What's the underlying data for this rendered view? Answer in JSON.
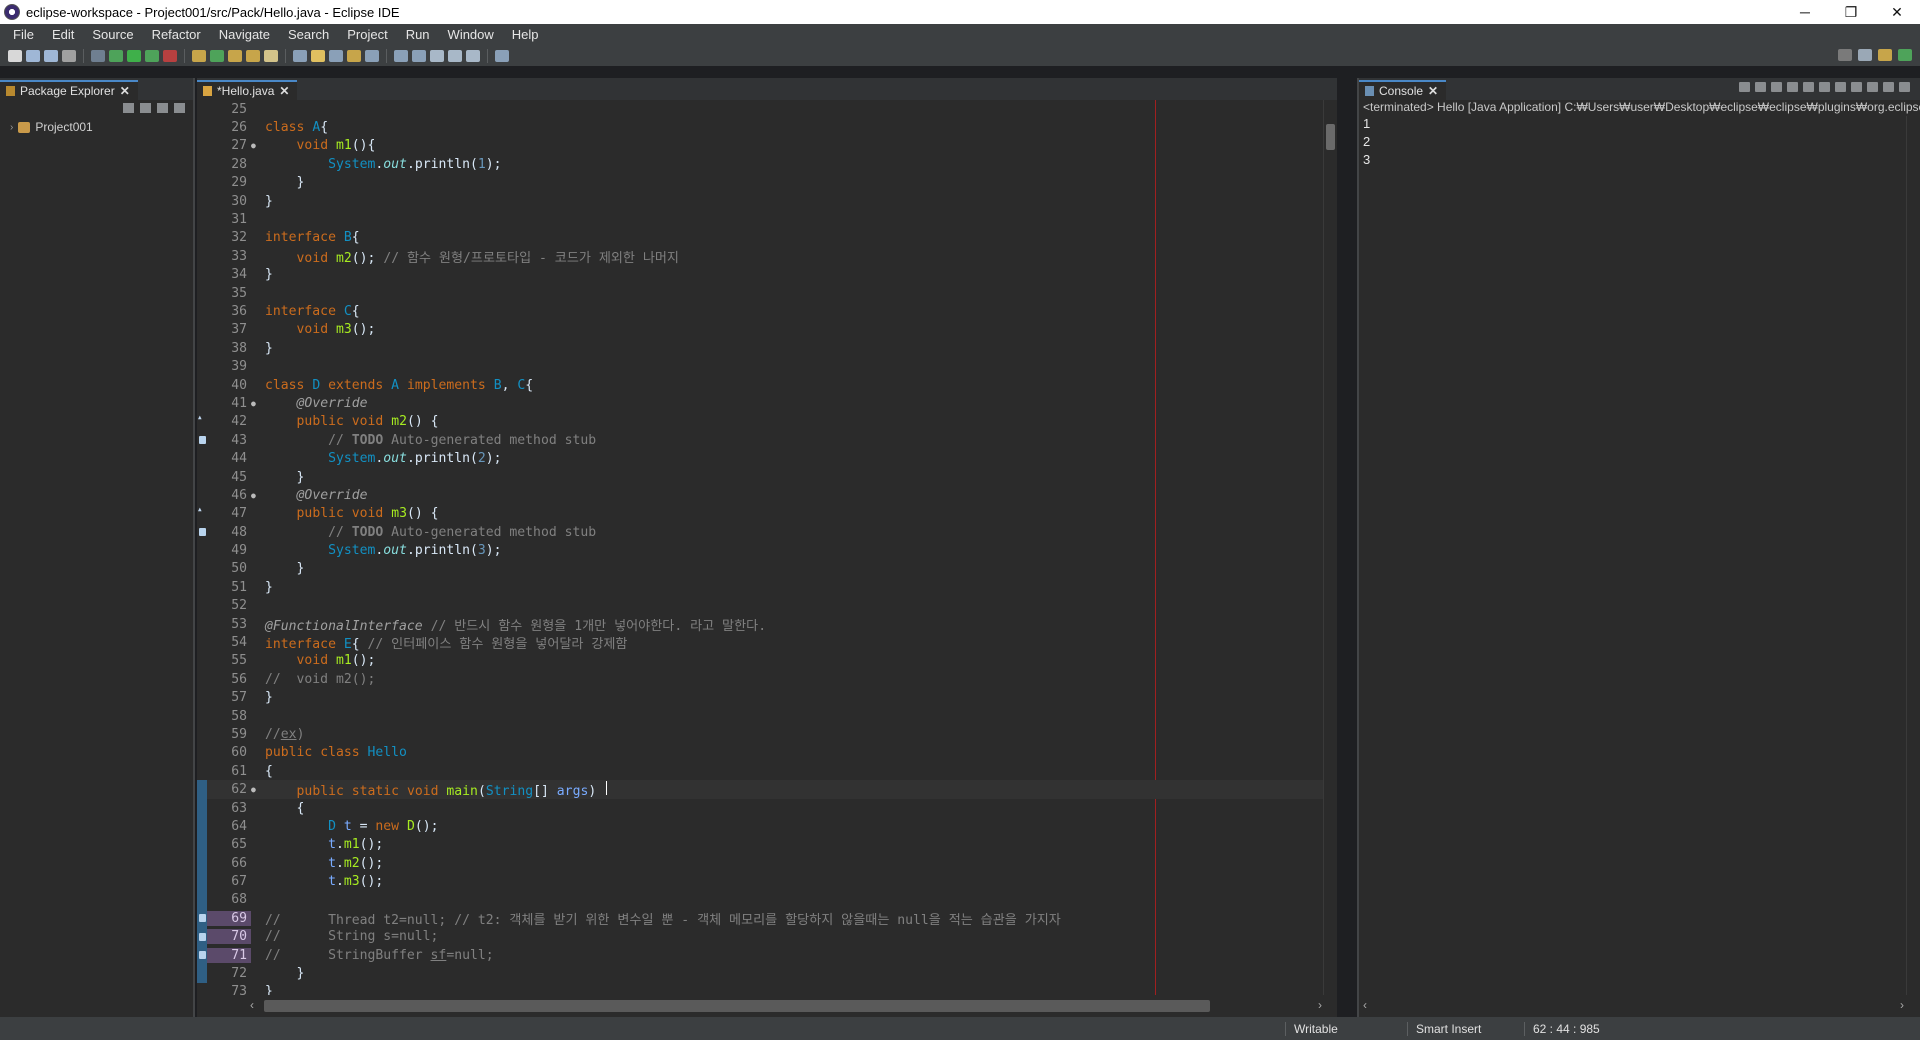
{
  "window": {
    "title": "eclipse-workspace - Project001/src/Pack/Hello.java - Eclipse IDE",
    "minimize": "─",
    "restore": "❐",
    "close": "✕"
  },
  "menu": [
    "File",
    "Edit",
    "Source",
    "Refactor",
    "Navigate",
    "Search",
    "Project",
    "Run",
    "Window",
    "Help"
  ],
  "package_explorer": {
    "tab_label": "Package Explorer",
    "close_glyph": "✕",
    "project": "Project001"
  },
  "editor": {
    "tab_label": "*Hello.java",
    "close_glyph": "✕"
  },
  "console": {
    "tab_label": "Console",
    "close_glyph": "✕",
    "header": "<terminated> Hello [Java Application] C:₩Users₩user₩Desktop₩eclipse₩eclipse₩plugins₩org.eclipse.j",
    "output": [
      "1",
      "2",
      "3"
    ]
  },
  "status": {
    "writable": "Writable",
    "insert_mode": "Smart Insert",
    "position": "62 : 44 : 985"
  },
  "colors": {
    "keyword": "#cc6c1d",
    "type": "#1290c3",
    "comment": "#808080",
    "background": "#2b2b2b"
  },
  "code_lines": [
    {
      "n": "25",
      "html": ""
    },
    {
      "n": "26",
      "html": "<span class='kw'>class</span> <span class='typ'>A</span>{"
    },
    {
      "n": "27",
      "fold": "●",
      "html": "    <span class='kw'>void</span> <span class='meth'>m1</span>(){"
    },
    {
      "n": "28",
      "html": "        <span class='typ'>System</span>.<span class='field'>out</span>.println(<span class='num'>1</span>);"
    },
    {
      "n": "29",
      "html": "    }"
    },
    {
      "n": "30",
      "html": "}"
    },
    {
      "n": "31",
      "html": ""
    },
    {
      "n": "32",
      "html": "<span class='kw'>interface</span> <span class='typ'>B</span>{"
    },
    {
      "n": "33",
      "html": "    <span class='kw'>void</span> <span class='meth'>m2</span>(); <span class='cmt'>// 함수 원형/프로토타입 - 코드가 제외한 나머지</span>"
    },
    {
      "n": "34",
      "html": "}"
    },
    {
      "n": "35",
      "html": ""
    },
    {
      "n": "36",
      "html": "<span class='kw'>interface</span> <span class='typ'>C</span>{"
    },
    {
      "n": "37",
      "html": "    <span class='kw'>void</span> <span class='meth'>m3</span>();"
    },
    {
      "n": "38",
      "html": "}"
    },
    {
      "n": "39",
      "html": ""
    },
    {
      "n": "40",
      "html": "<span class='kw'>class</span> <span class='typ'>D</span> <span class='kw'>extends</span> <span class='typ'>A</span> <span class='kw'>implements</span> <span class='typ'>B</span>, <span class='typ'>C</span>{"
    },
    {
      "n": "41",
      "fold": "●",
      "html": "    <span class='ann'>@Override</span>"
    },
    {
      "n": "42",
      "mark": "arrow",
      "html": "    <span class='kw'>public</span> <span class='kw'>void</span> <span class='meth'>m2</span>() {"
    },
    {
      "n": "43",
      "mark": "task",
      "html": "        <span class='cmt'>// <b>TODO</b> Auto-generated method stub</span>"
    },
    {
      "n": "44",
      "html": "        <span class='typ'>System</span>.<span class='field'>out</span>.println(<span class='num'>2</span>);"
    },
    {
      "n": "45",
      "html": "    }"
    },
    {
      "n": "46",
      "fold": "●",
      "html": "    <span class='ann'>@Override</span>"
    },
    {
      "n": "47",
      "mark": "arrow",
      "html": "    <span class='kw'>public</span> <span class='kw'>void</span> <span class='meth'>m3</span>() {"
    },
    {
      "n": "48",
      "mark": "task",
      "html": "        <span class='cmt'>// <b>TODO</b> Auto-generated method stub</span>"
    },
    {
      "n": "49",
      "html": "        <span class='typ'>System</span>.<span class='field'>out</span>.println(<span class='num'>3</span>);"
    },
    {
      "n": "50",
      "html": "    }"
    },
    {
      "n": "51",
      "html": "}"
    },
    {
      "n": "52",
      "html": ""
    },
    {
      "n": "53",
      "html": "<span class='ann'>@FunctionalInterface</span> <span class='cmt'>// 반드시 함수 원형을 1개만 넣어야한다. 라고 말한다.</span>"
    },
    {
      "n": "54",
      "html": "<span class='kw'>interface</span> <span class='typ'>E</span>{ <span class='cmt'>// 인터페이스 함수 원형을 넣어달라 강제함</span>"
    },
    {
      "n": "55",
      "html": "    <span class='kw'>void</span> <span class='meth'>m1</span>();"
    },
    {
      "n": "56",
      "html": "<span class='cmt'>//  void m2();</span>"
    },
    {
      "n": "57",
      "html": "}"
    },
    {
      "n": "58",
      "html": ""
    },
    {
      "n": "59",
      "html": "<span class='cmt'>//<u>ex</u>)</span>"
    },
    {
      "n": "60",
      "html": "<span class='kw'>public</span> <span class='kw'>class</span> <span class='typ'>Hello</span>"
    },
    {
      "n": "61",
      "html": "{"
    },
    {
      "n": "62",
      "fold": "●",
      "current": true,
      "changed": true,
      "html": "    <span class='kw'>public</span> <span class='kw'>static</span> <span class='kw'>void</span> <span class='meth'>main</span>(<span class='typ'>String</span>[] <span class='var'>args</span>) <span class='caret'></span>"
    },
    {
      "n": "63",
      "changed": true,
      "html": "    {"
    },
    {
      "n": "64",
      "changed": true,
      "html": "        <span class='typ'>D</span> <span class='var'>t</span> = <span class='kw'>new</span> <span class='meth'>D</span>();"
    },
    {
      "n": "65",
      "changed": true,
      "html": "        <span class='var'>t</span>.<span class='meth'>m1</span>();"
    },
    {
      "n": "66",
      "changed": true,
      "html": "        <span class='var'>t</span>.<span class='meth'>m2</span>();"
    },
    {
      "n": "67",
      "changed": true,
      "html": "        <span class='var'>t</span>.<span class='meth'>m3</span>();"
    },
    {
      "n": "68",
      "changed": true,
      "html": ""
    },
    {
      "n": "69",
      "changed": true,
      "hl": true,
      "mark": "task",
      "html": "<span class='cmt'>//      Thread t2=null; // t2: 객체를 받기 위한 변수일 뿐 - 객체 메모리를 할당하지 않을때는 null을 적는 습관을 가지자</span>"
    },
    {
      "n": "70",
      "changed": true,
      "hl": true,
      "mark": "task",
      "html": "<span class='cmt'>//      String s=null;</span>"
    },
    {
      "n": "71",
      "changed": true,
      "hl": true,
      "mark": "task",
      "html": "<span class='cmt'>//      StringBuffer <u>sf</u>=null;</span>"
    },
    {
      "n": "72",
      "changed": true,
      "html": "    }"
    },
    {
      "n": "73",
      "html": "}"
    }
  ]
}
